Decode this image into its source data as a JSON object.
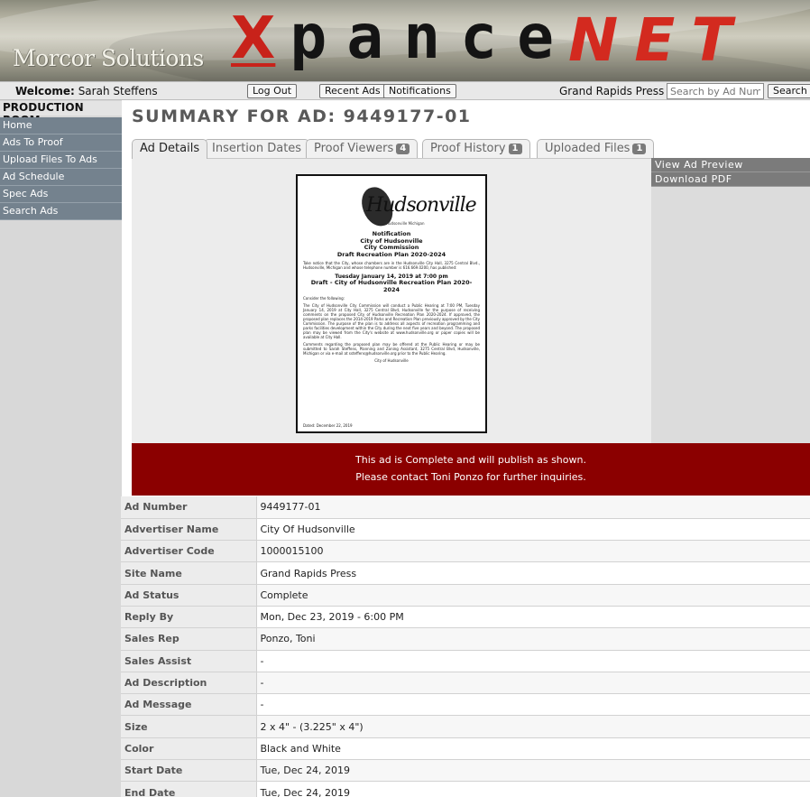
{
  "brand": {
    "company": "Morcor Solutions",
    "logo_x": "X",
    "logo_pance": "pance",
    "logo_net": "NET"
  },
  "topbar": {
    "welcome_label": "Welcome:",
    "user_name": "Sarah Steffens",
    "logout": "Log Out",
    "recent_ads": "Recent Ads",
    "notifications": "Notifications",
    "publication": "Grand Rapids Press",
    "search_placeholder": "Search by Ad Number",
    "search_button": "Search"
  },
  "sidebar": {
    "title": "PRODUCTION ROOM",
    "items": [
      "Home",
      "Ads To Proof",
      "Upload Files To Ads",
      "Ad Schedule",
      "Spec Ads",
      "Search Ads"
    ]
  },
  "page": {
    "title": "SUMMARY FOR AD: 9449177-01"
  },
  "tabs": [
    {
      "label": "Ad Details",
      "badge": ""
    },
    {
      "label": "Insertion Dates",
      "badge": ""
    },
    {
      "label": "Proof Viewers",
      "badge": "4"
    },
    {
      "label": "Proof History",
      "badge": "1"
    },
    {
      "label": "Uploaded Files",
      "badge": "1"
    }
  ],
  "actions": {
    "view_preview": "View Ad Preview",
    "download_pdf": "Download PDF"
  },
  "proof": {
    "logo_text": "Hudsonville",
    "logo_sub": "Hudsonville Michigan",
    "h1": "Notification",
    "h2": "City of Hudsonville",
    "h3": "City Commission",
    "h4": "Draft Recreation Plan 2020-2024",
    "p1": "Take notice that the City, whose chambers are in the Hudsonville City Hall, 3275 Central Blvd., Hudsonville, Michigan and whose telephone number is 616.669.0200, has published:",
    "h5": "Tuesday January 14, 2019 at 7:00 pm",
    "h6": "Draft - City of Hudsonville Recreation Plan 2020-2024",
    "p2": "Consider the following:",
    "p3": "The City of Hudsonville City Commission will conduct a Public Hearing at 7:00 PM, Tuesday January 14, 2019 at City Hall, 3275 Central Blvd, Hudsonville for the purpose of receiving comments on the proposed City of Hudsonville Recreation Plan 2020-2024. If approved, the proposed plan replaces the 2014-2019 Parks and Recreation Plan previously approved by the City Commission. The purpose of the plan is to address all aspects of recreation programming and parks facilities development within the City during the next five years and beyond. The proposed plan may be viewed from the City's website at www.hudsonville.org or paper copies will be available at City Hall.",
    "p4": "Comments regarding the proposed plan may be offered at the Public Hearing or may be submitted to Sarah Steffens, Planning and Zoning Assistant, 3275 Central Blvd, Hudsonville, Michigan or via e-mail at ssteffens@hudsonville.org prior to the Public Hearing.",
    "sign": "City of Hudsonville",
    "dated": "Dated: December 22, 2019"
  },
  "status": {
    "line1": "This ad is Complete and will publish as shown.",
    "line2": "Please contact Toni Ponzo for further inquiries."
  },
  "details": [
    {
      "key": "Ad Number",
      "value": "9449177-01"
    },
    {
      "key": "Advertiser Name",
      "value": "City Of Hudsonville"
    },
    {
      "key": "Advertiser Code",
      "value": "1000015100"
    },
    {
      "key": "Site Name",
      "value": "Grand Rapids Press"
    },
    {
      "key": "Ad Status",
      "value": "Complete"
    },
    {
      "key": "Reply By",
      "value": "Mon, Dec 23, 2019 - 6:00 PM"
    },
    {
      "key": "Sales Rep",
      "value": "Ponzo, Toni"
    },
    {
      "key": "Sales Assist",
      "value": "-"
    },
    {
      "key": "Ad Description",
      "value": "-"
    },
    {
      "key": "Ad Message",
      "value": "-"
    },
    {
      "key": "Size",
      "value": "2 x 4\" - (3.225\" x 4\")"
    },
    {
      "key": "Color",
      "value": "Black and White"
    },
    {
      "key": "Start Date",
      "value": "Tue, Dec 24, 2019"
    },
    {
      "key": "End Date",
      "value": "Tue, Dec 24, 2019"
    }
  ],
  "colors": {
    "brand_red": "#c8221a",
    "nav_bg": "#74828e",
    "status_red": "#8b0000"
  }
}
